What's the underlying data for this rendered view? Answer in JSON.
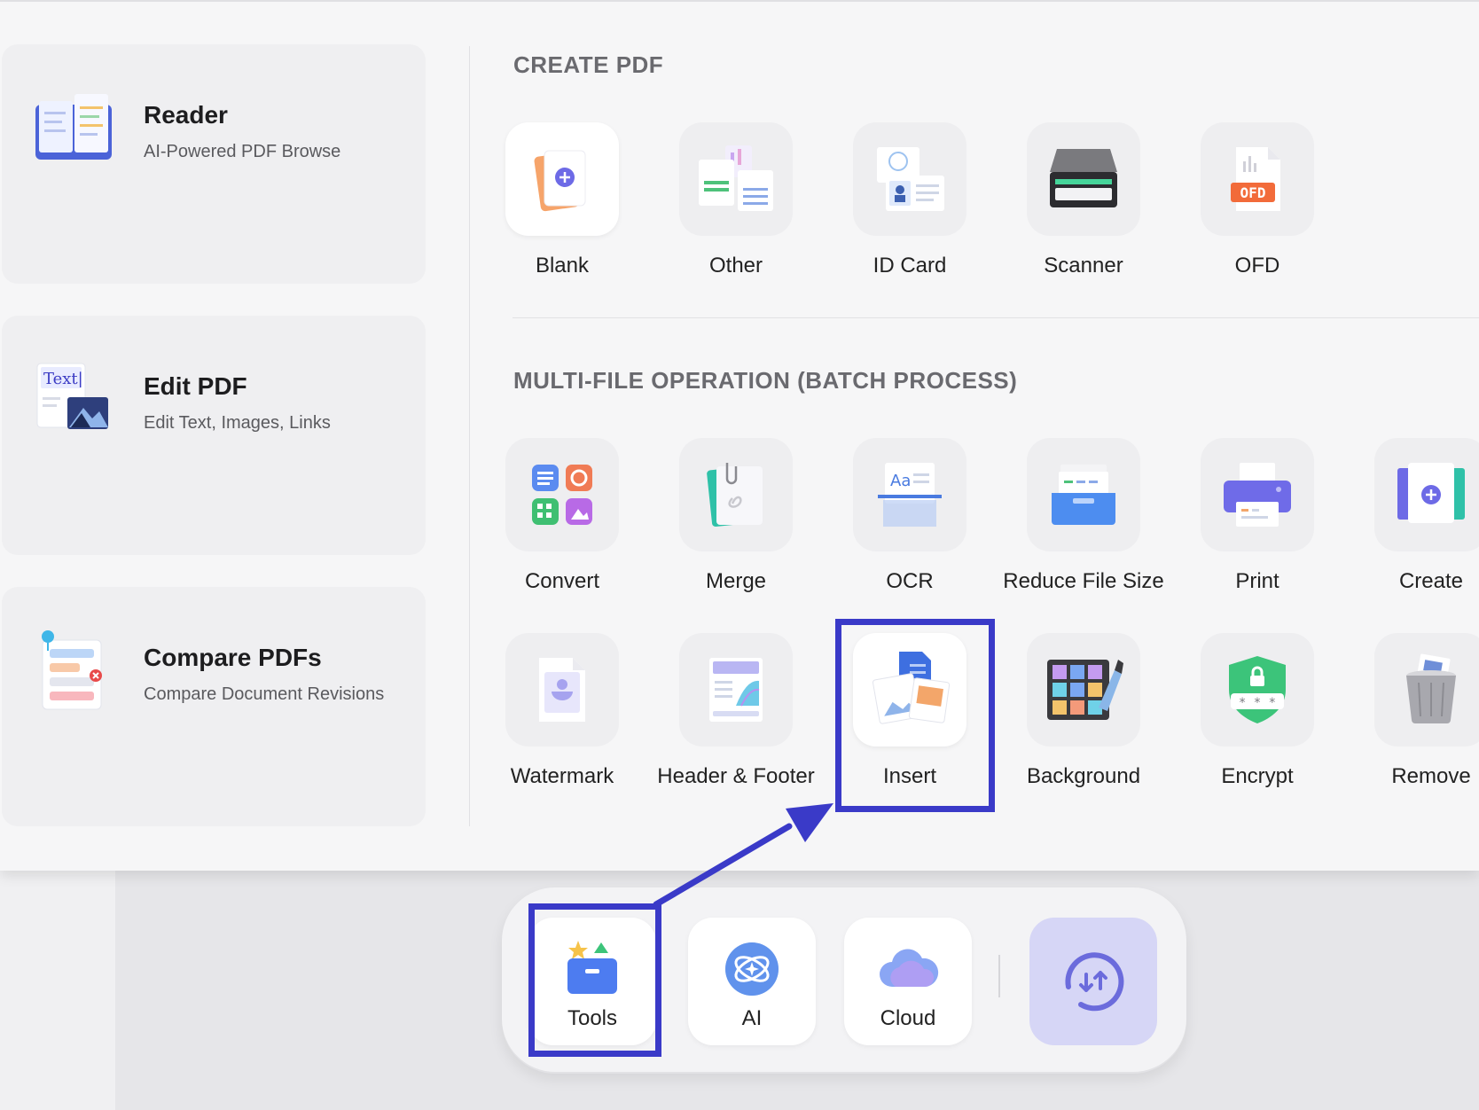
{
  "features": [
    {
      "title": "Reader",
      "subtitle": "AI-Powered PDF Browse",
      "icon": "book-icon"
    },
    {
      "title": "Edit PDF",
      "subtitle": "Edit Text, Images, Links",
      "icon": "edit-text-icon",
      "icon_text": "Text|"
    },
    {
      "title": "Compare PDFs",
      "subtitle": "Compare Document Revisions",
      "icon": "compare-icon"
    }
  ],
  "create_pdf": {
    "title": "CREATE PDF",
    "items": [
      {
        "label": "Blank",
        "icon": "blank-page-icon"
      },
      {
        "label": "Other",
        "icon": "other-files-icon"
      },
      {
        "label": "ID Card",
        "icon": "id-card-icon"
      },
      {
        "label": "Scanner",
        "icon": "scanner-icon"
      },
      {
        "label": "OFD",
        "icon": "ofd-icon",
        "icon_text": "OFD"
      }
    ]
  },
  "batch": {
    "title": "MULTI-FILE OPERATION (BATCH PROCESS)",
    "row1": [
      {
        "label": "Convert",
        "icon": "convert-icon"
      },
      {
        "label": "Merge",
        "icon": "merge-icon"
      },
      {
        "label": "OCR",
        "icon": "ocr-icon",
        "icon_text": "Aa"
      },
      {
        "label": "Reduce File Size",
        "icon": "compress-icon"
      },
      {
        "label": "Print",
        "icon": "printer-icon"
      },
      {
        "label": "Create",
        "icon": "create-icon"
      }
    ],
    "row2": [
      {
        "label": "Watermark",
        "icon": "watermark-icon"
      },
      {
        "label": "Header & Footer",
        "icon": "header-footer-icon"
      },
      {
        "label": "Insert",
        "icon": "insert-icon",
        "highlighted": true
      },
      {
        "label": "Background",
        "icon": "palette-icon"
      },
      {
        "label": "Encrypt",
        "icon": "shield-lock-icon",
        "icon_text": "* * *"
      },
      {
        "label": "Remove",
        "icon": "trash-icon"
      }
    ]
  },
  "dock": {
    "items": [
      {
        "label": "Tools",
        "icon": "toolbox-icon",
        "highlighted": true
      },
      {
        "label": "AI",
        "icon": "ai-icon"
      },
      {
        "label": "Cloud",
        "icon": "cloud-icon"
      }
    ],
    "sync_icon": "sync-icon"
  },
  "colors": {
    "highlight": "#3a3ac8",
    "accent": "#6b6bdc",
    "panel": "#f6f6f7"
  }
}
